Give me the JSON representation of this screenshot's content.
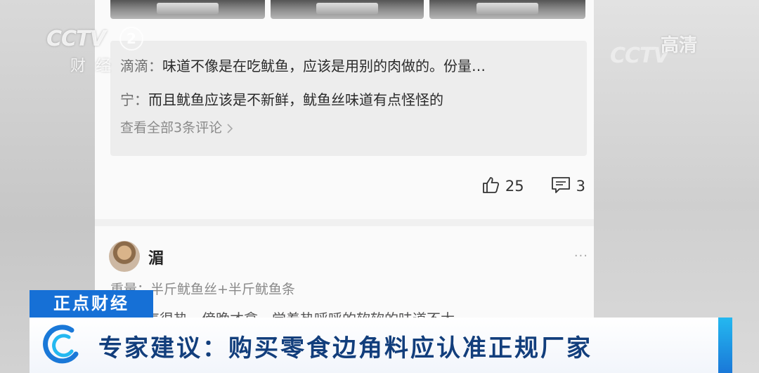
{
  "channel": {
    "logo": "CCTV",
    "number": "2",
    "sub": "财经",
    "quality": "高清",
    "watermark": "CCTV"
  },
  "post": {
    "comments": [
      {
        "name": "滴滴：",
        "text": "味道不像是在吃鱿鱼，应该是用别的肉做的。份量…"
      },
      {
        "name": "宁：",
        "text": "而且鱿鱼应该是不新鲜，鱿鱼丝味道有点怪怪的"
      }
    ],
    "view_all": "查看全部3条评论",
    "likes": "25",
    "comment_count": "3"
  },
  "review": {
    "username": "湄",
    "more": "···",
    "weight_label": "重量：",
    "weight_value": "半斤鱿鱼丝+半斤鱿鱼条",
    "partial_text": "天气很热，傍晚才拿，觉着热呼呼的软软的味道不太"
  },
  "overlay": {
    "program": "正点财经",
    "headline": "专家建议：购买零食边角料应认准正规厂家"
  },
  "colors": {
    "program_bg": "#1670d6",
    "headline_text": "#123e7c",
    "ticker_accent": "#24b8f0"
  }
}
